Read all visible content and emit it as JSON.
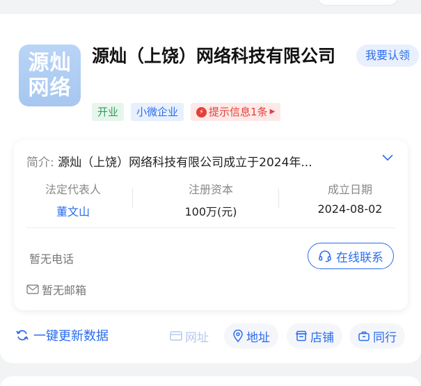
{
  "company": {
    "logo_line1": "源灿",
    "logo_line2": "网络",
    "name": "源灿（上饶）网络科技有限公司",
    "claim_label": "我要认领"
  },
  "tags": {
    "status": "开业",
    "size": "小微企业",
    "alert": "提示信息1条"
  },
  "intro": {
    "label": "简介:",
    "text": "源灿（上饶）网络科技有限公司成立于2024年..."
  },
  "stats": {
    "legal_rep_label": "法定代表人",
    "legal_rep_value": "董文山",
    "capital_label": "注册资本",
    "capital_value": "100万(元)",
    "date_label": "成立日期",
    "date_value": "2024-08-02"
  },
  "contact": {
    "phone": "暂无电话",
    "online_label": "在线联系",
    "email": "暂无邮箱"
  },
  "actions": {
    "refresh_label": "一键更新数据",
    "website": "网址",
    "address": "地址",
    "store": "店铺",
    "peers": "同行"
  },
  "colors": {
    "accent": "#2a6cf0",
    "green": "#2f9e5c",
    "red": "#e2403a"
  }
}
